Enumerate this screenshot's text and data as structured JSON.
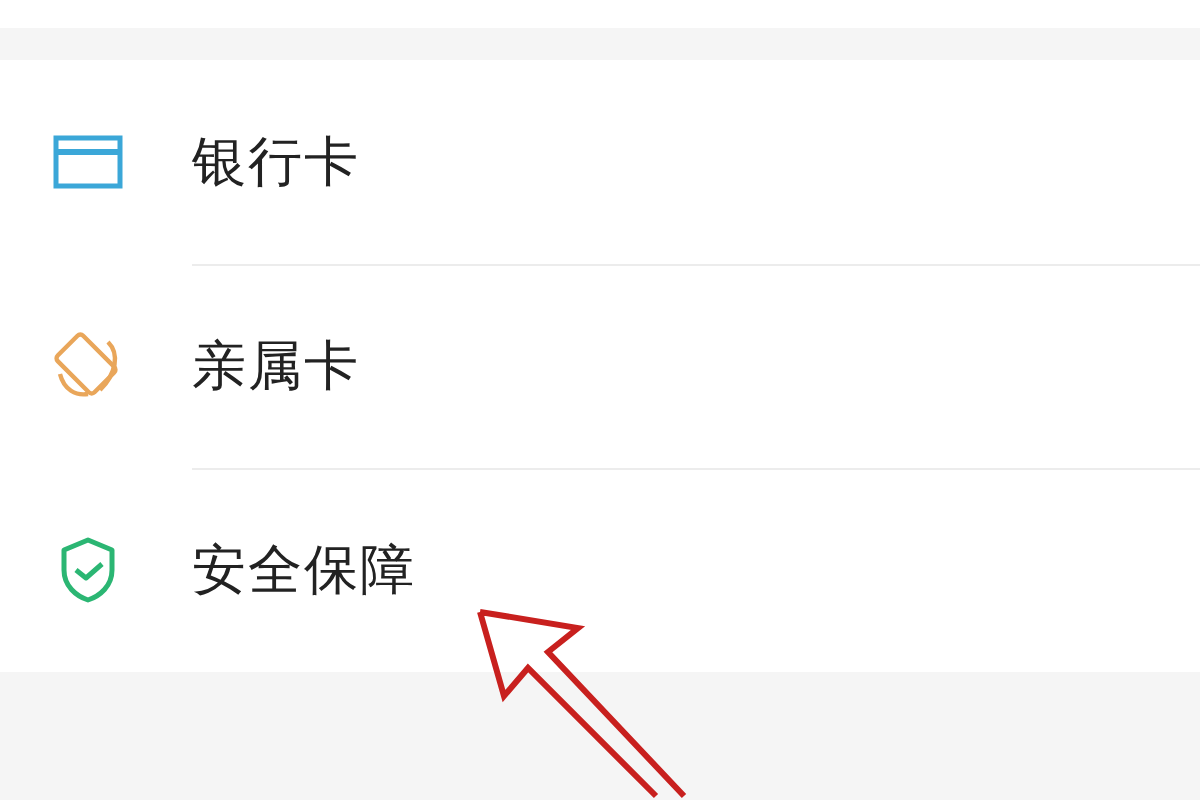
{
  "menu_items": [
    {
      "kind": "bank-card",
      "label": "银行卡"
    },
    {
      "kind": "family-card",
      "label": "亲属卡"
    },
    {
      "kind": "security",
      "label": "安全保障"
    }
  ]
}
